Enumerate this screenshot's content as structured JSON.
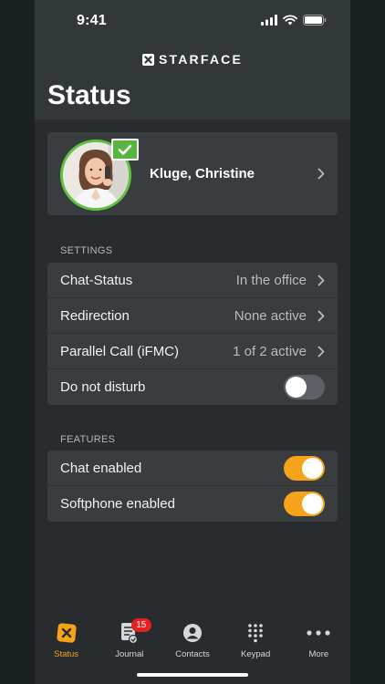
{
  "status_bar": {
    "time": "9:41"
  },
  "brand": {
    "name": "STARFACE"
  },
  "page": {
    "title": "Status"
  },
  "profile": {
    "name": "Kluge, Christine",
    "presence_color": "#58b640"
  },
  "settings": {
    "header": "SETTINGS",
    "rows": [
      {
        "label": "Chat-Status",
        "value": "In the office"
      },
      {
        "label": "Redirection",
        "value": "None active"
      },
      {
        "label": "Parallel Call (iFMC)",
        "value": "1 of 2 active"
      }
    ],
    "dnd": {
      "label": "Do not disturb",
      "enabled": false
    }
  },
  "features": {
    "header": "FEATURES",
    "rows": [
      {
        "label": "Chat enabled",
        "enabled": true
      },
      {
        "label": "Softphone enabled",
        "enabled": true
      }
    ]
  },
  "tabs": [
    {
      "label": "Status",
      "icon": "star-icon",
      "active": true
    },
    {
      "label": "Journal",
      "icon": "journal-icon",
      "badge": "15"
    },
    {
      "label": "Contacts",
      "icon": "person-icon"
    },
    {
      "label": "Keypad",
      "icon": "keypad-icon"
    },
    {
      "label": "More",
      "icon": "more-icon"
    }
  ],
  "colors": {
    "accent": "#f5a31a",
    "presence": "#5fc341",
    "badge": "#e52020"
  }
}
